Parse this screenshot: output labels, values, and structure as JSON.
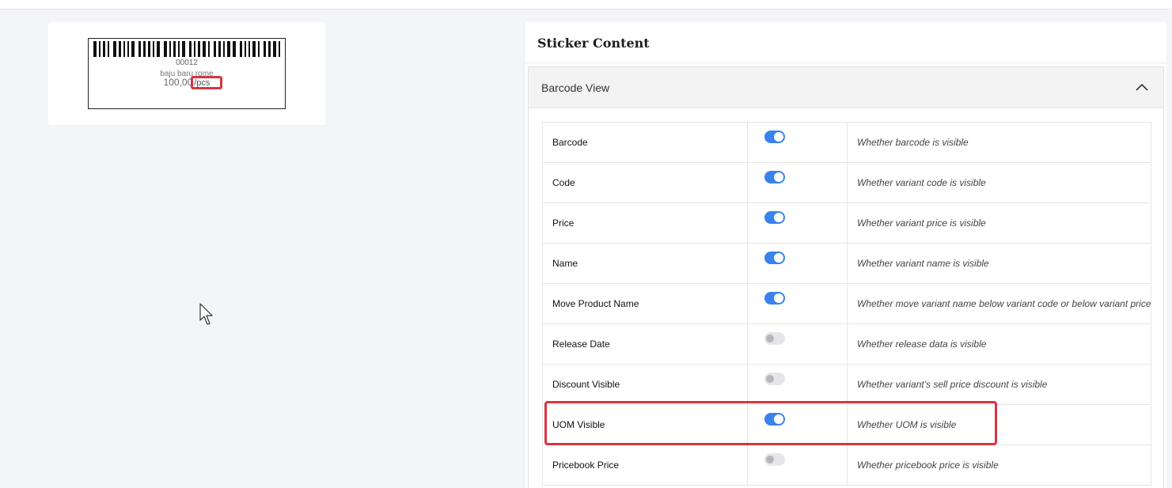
{
  "colors": {
    "accent": "#3a82ee",
    "highlight": "#d9343f",
    "toggle_off": "#e6e6ea"
  },
  "preview": {
    "code": "00012",
    "name": "baju baru rome",
    "price": "100,00",
    "uom": "/pcs"
  },
  "panel": {
    "title": "Sticker Content",
    "accordion_title": "Barcode View",
    "accordion_icon": "chevron-up-icon"
  },
  "rows": [
    {
      "label": "Barcode",
      "enabled": true,
      "description": "Whether barcode is visible"
    },
    {
      "label": "Code",
      "enabled": true,
      "description": "Whether variant code is visible"
    },
    {
      "label": "Price",
      "enabled": true,
      "description": "Whether variant price is visible"
    },
    {
      "label": "Name",
      "enabled": true,
      "description": "Whether variant name is visible"
    },
    {
      "label": "Move Product Name",
      "enabled": true,
      "description": "Whether move variant name below variant code or below variant price"
    },
    {
      "label": "Release Date",
      "enabled": false,
      "description": "Whether release data is visible"
    },
    {
      "label": "Discount Visible",
      "enabled": false,
      "description": "Whether variant's sell price discount is visible"
    },
    {
      "label": "UOM Visible",
      "enabled": true,
      "description": "Whether UOM is visible"
    },
    {
      "label": "Pricebook Price",
      "enabled": false,
      "description": "Whether pricebook price is visible"
    }
  ]
}
